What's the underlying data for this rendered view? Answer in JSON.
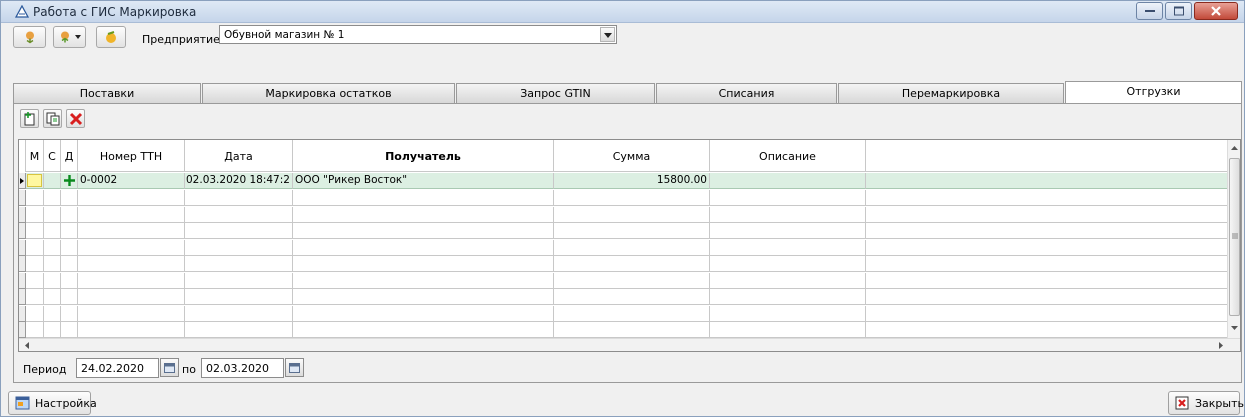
{
  "window": {
    "title": "Работа с ГИС Маркировка"
  },
  "toolbar": {
    "company_label": "Предприятие",
    "company_value": "Обувной магазин № 1"
  },
  "tabs": [
    {
      "label": "Поставки"
    },
    {
      "label": "Маркировка остатков"
    },
    {
      "label": "Запрос GTIN"
    },
    {
      "label": "Списания"
    },
    {
      "label": "Перемаркировка"
    },
    {
      "label": "Отгрузки",
      "active": true
    }
  ],
  "grid": {
    "columns": [
      "М",
      "С",
      "Д",
      "Номер ТТН",
      "Дата",
      "Получатель",
      "Сумма",
      "Описание"
    ],
    "rows": [
      {
        "number": "0-0002",
        "date": "02.03.2020 18:47:2",
        "recipient": "ООО \"Рикер Восток\"",
        "sum": "15800.00",
        "description": ""
      }
    ]
  },
  "period": {
    "label": "Период",
    "from": "24.02.2020",
    "to_label": "по",
    "to": "02.03.2020"
  },
  "footer": {
    "settings_label": "Настройка",
    "close_label": "Закрыть"
  },
  "colors": {
    "selected_row": "#dcefe2",
    "accent_green": "#0a8a1e",
    "delete_red": "#d81e1e"
  },
  "icons": [
    "app-icon",
    "minimize-icon",
    "maximize-icon",
    "close-icon",
    "add-icon",
    "copy-icon",
    "delete-icon",
    "calendar-icon",
    "settings-icon",
    "exit-icon"
  ]
}
